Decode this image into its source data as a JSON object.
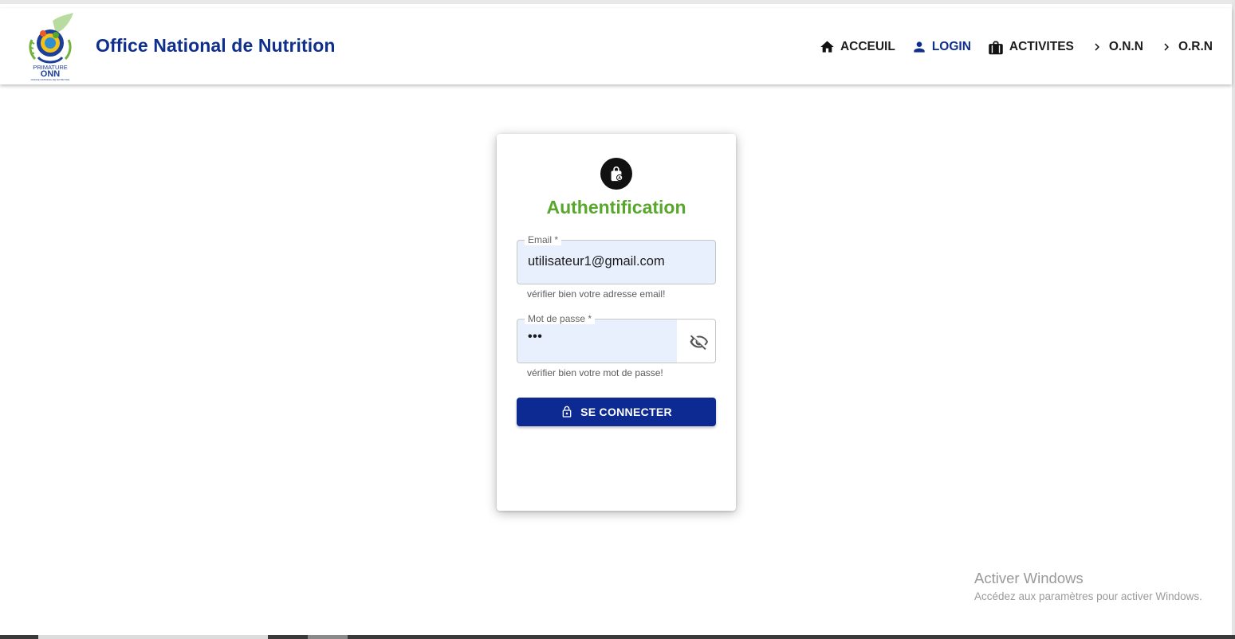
{
  "header": {
    "title": "Office National de Nutrition",
    "logo": {
      "top_text": "PRIMATURE",
      "mark": "ONN",
      "small_text": "OFFICE NATIONAL DE NUTRITION"
    },
    "nav": [
      {
        "label": "ACCEUIL",
        "icon": "home-icon",
        "active": false
      },
      {
        "label": "LOGIN",
        "icon": "person-icon",
        "active": true
      },
      {
        "label": "ACTIVITES",
        "icon": "briefcase-icon",
        "active": false
      },
      {
        "label": "O.N.N",
        "icon": "chevron-right-icon",
        "active": false
      },
      {
        "label": "O.R.N",
        "icon": "chevron-right-icon",
        "active": false
      }
    ]
  },
  "login": {
    "title": "Authentification",
    "email": {
      "label": "Email *",
      "value": "utilisateur1@gmail.com",
      "helper": "vérifier bien votre adresse email!"
    },
    "password": {
      "label": "Mot de passe *",
      "masked_value": "•••",
      "helper": "vérifier bien votre mot de passe!"
    },
    "submit_label": "SE CONNECTER"
  },
  "watermark": {
    "title": "Activer Windows",
    "subtitle": "Accédez aux paramètres pour activer Windows."
  },
  "colors": {
    "brand_blue": "#0f2f8e",
    "button_blue": "#0d2a93",
    "title_green": "#58a62b",
    "autofill_bg": "#e8f0fe"
  }
}
